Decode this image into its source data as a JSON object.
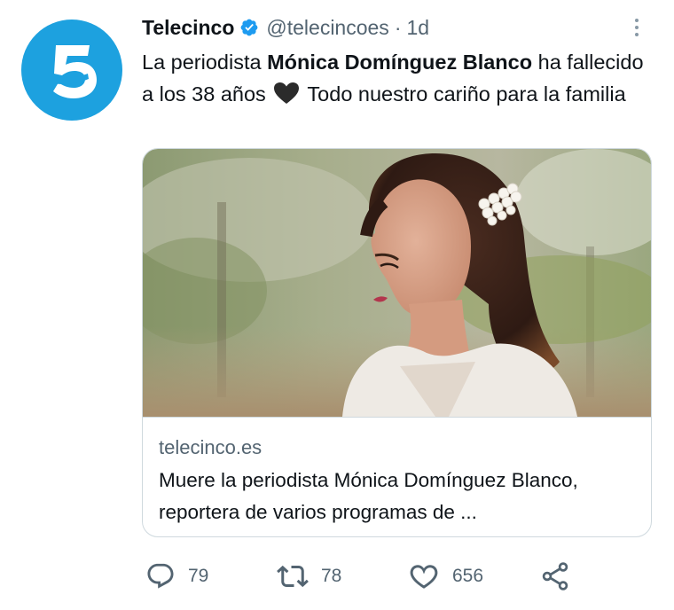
{
  "account": {
    "display_name": "Telecinco",
    "handle": "@telecincoes",
    "separator": "·",
    "timestamp": "1d",
    "verified": true,
    "avatar_glyph": "5"
  },
  "tweet": {
    "text_part1": "La periodista ",
    "text_bold": "Mónica Domínguez Blanco",
    "text_part2": " ha fallecido a los 38 años ",
    "emoji": "black-heart",
    "text_part3": " Todo nuestro cariño para la familia"
  },
  "card": {
    "domain": "telecinco.es",
    "title": "Muere la periodista Mónica Domínguez Blanco, reportera de varios programas de ..."
  },
  "actions": {
    "replies": "79",
    "retweets": "78",
    "likes": "656"
  },
  "colors": {
    "brand": "#1da1df",
    "verified": "#1d9bf0",
    "secondary_text": "#536471",
    "border": "#cfd9de"
  },
  "icons": [
    "telecinco-logo-icon",
    "verified-icon",
    "more-icon",
    "heart-emoji-icon",
    "reply-icon",
    "retweet-icon",
    "like-icon",
    "share-icon"
  ]
}
